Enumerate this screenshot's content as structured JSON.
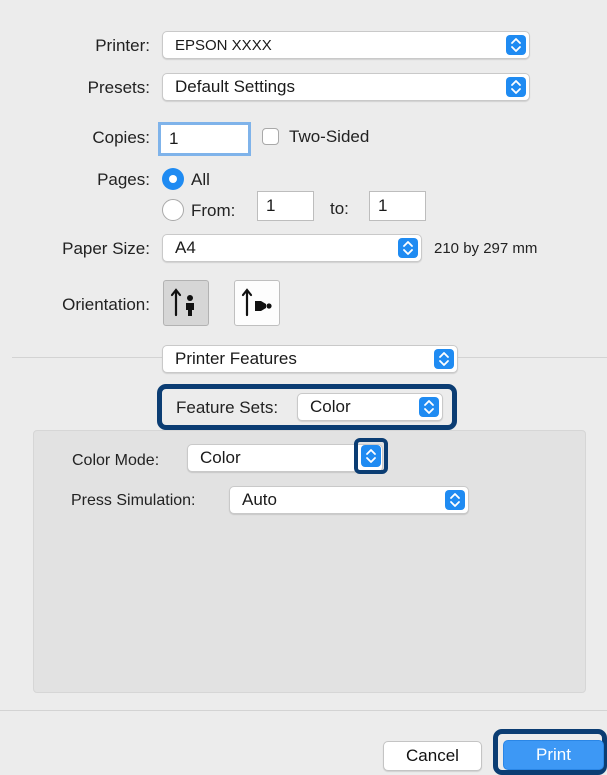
{
  "printer": {
    "label": "Printer:",
    "value": "EPSON XXXX"
  },
  "presets": {
    "label": "Presets:",
    "value": "Default Settings"
  },
  "copies": {
    "label": "Copies:",
    "value": "1",
    "two_sided_label": "Two-Sided"
  },
  "pages": {
    "label": "Pages:",
    "all_label": "All",
    "from_label": "From:",
    "from_value": "1",
    "to_label": "to:",
    "to_value": "1"
  },
  "paper_size": {
    "label": "Paper Size:",
    "value": "A4",
    "dimensions": "210 by 297 mm"
  },
  "orientation": {
    "label": "Orientation:"
  },
  "panel_selector": {
    "value": "Printer Features"
  },
  "feature_sets": {
    "label": "Feature Sets:",
    "value": "Color"
  },
  "color_mode": {
    "label": "Color Mode:",
    "value": "Color"
  },
  "press_simulation": {
    "label": "Press Simulation:",
    "value": "Auto"
  },
  "buttons": {
    "cancel": "Cancel",
    "print": "Print"
  },
  "colors": {
    "accent": "#1f8bf2",
    "highlight": "#0b3d73",
    "background": "#ececec"
  }
}
